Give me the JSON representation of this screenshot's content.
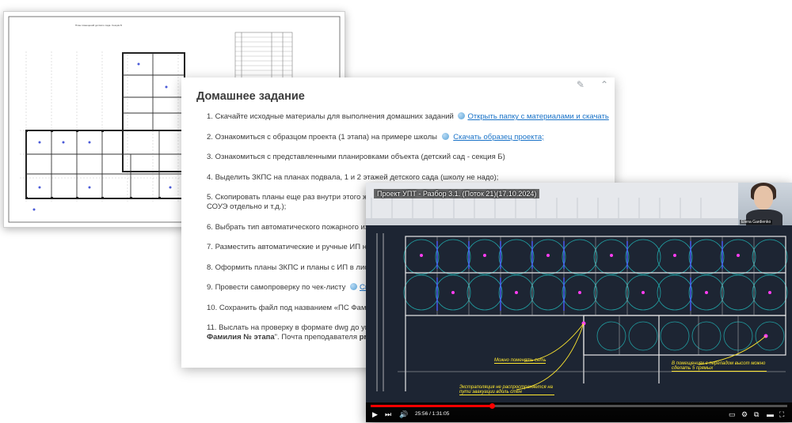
{
  "plan": {
    "caption": "План помещений детского сада. Секция Б"
  },
  "homework": {
    "title": "Домашнее задание",
    "items": [
      {
        "num": "1.",
        "text": "Скачайте исходные материалы для выполнения домашних заданий",
        "link": "Открыть папку с материалами и скачать"
      },
      {
        "num": "2.",
        "text": "Ознакомиться с образцом проекта (1 этапа) на примере школы",
        "link": "Скачать образец проекта;"
      },
      {
        "num": "3.",
        "text": "Ознакомиться с представленными планировками объекта (детский сад - секция Б)"
      },
      {
        "num": "4.",
        "text": "Выделить ЗКПС на планах подвала, 1 и 2 этажей детского сада (школу не надо);"
      },
      {
        "num": "5.",
        "text": "Скопировать планы еще раз внутри этого же раз"
      },
      {
        "num": "",
        "text": "СОУЭ отдельно и т.д.);"
      },
      {
        "num": "6.",
        "text": "Выбрать тип автоматического пожарного извещ"
      },
      {
        "num": "7.",
        "text": "Разместить автоматические и ручные ИП на кон"
      },
      {
        "num": "8.",
        "text": "Оформить планы ЗКПС и планы с ИП в листах;"
      },
      {
        "num": "9.",
        "text": "Провести самопроверку по чек-листу",
        "link": "Скачат"
      },
      {
        "num": "10.",
        "text": "Сохранить файл под названием «ПС Фамилия_1"
      },
      {
        "num": "11.",
        "text": "Выслать на проверку в формате dwg до указанн"
      },
      {
        "num": "",
        "bold": "Фамилия № этапа",
        "text": "\". Почта преподавателя",
        "bold_tail": "proekt"
      }
    ]
  },
  "video": {
    "title": "Проект УПТ - Разбор 3.1. (Поток 21)(17.10.2024)",
    "presenter": "Elena Gardienko",
    "time": "25:56 / 1:31:05",
    "progress": 0.29,
    "annotations": [
      "Можно поменять сеть",
      "Экстраполяция не распространяется на пути эвакуации вдоль стен",
      "В помещениях с перепадом высот можно сделать 5 прямых"
    ]
  },
  "colors": {
    "link": "#1a73c8",
    "cad_bg": "#1d2533",
    "progress": "#ff0000",
    "annotation": "#ffe830"
  }
}
